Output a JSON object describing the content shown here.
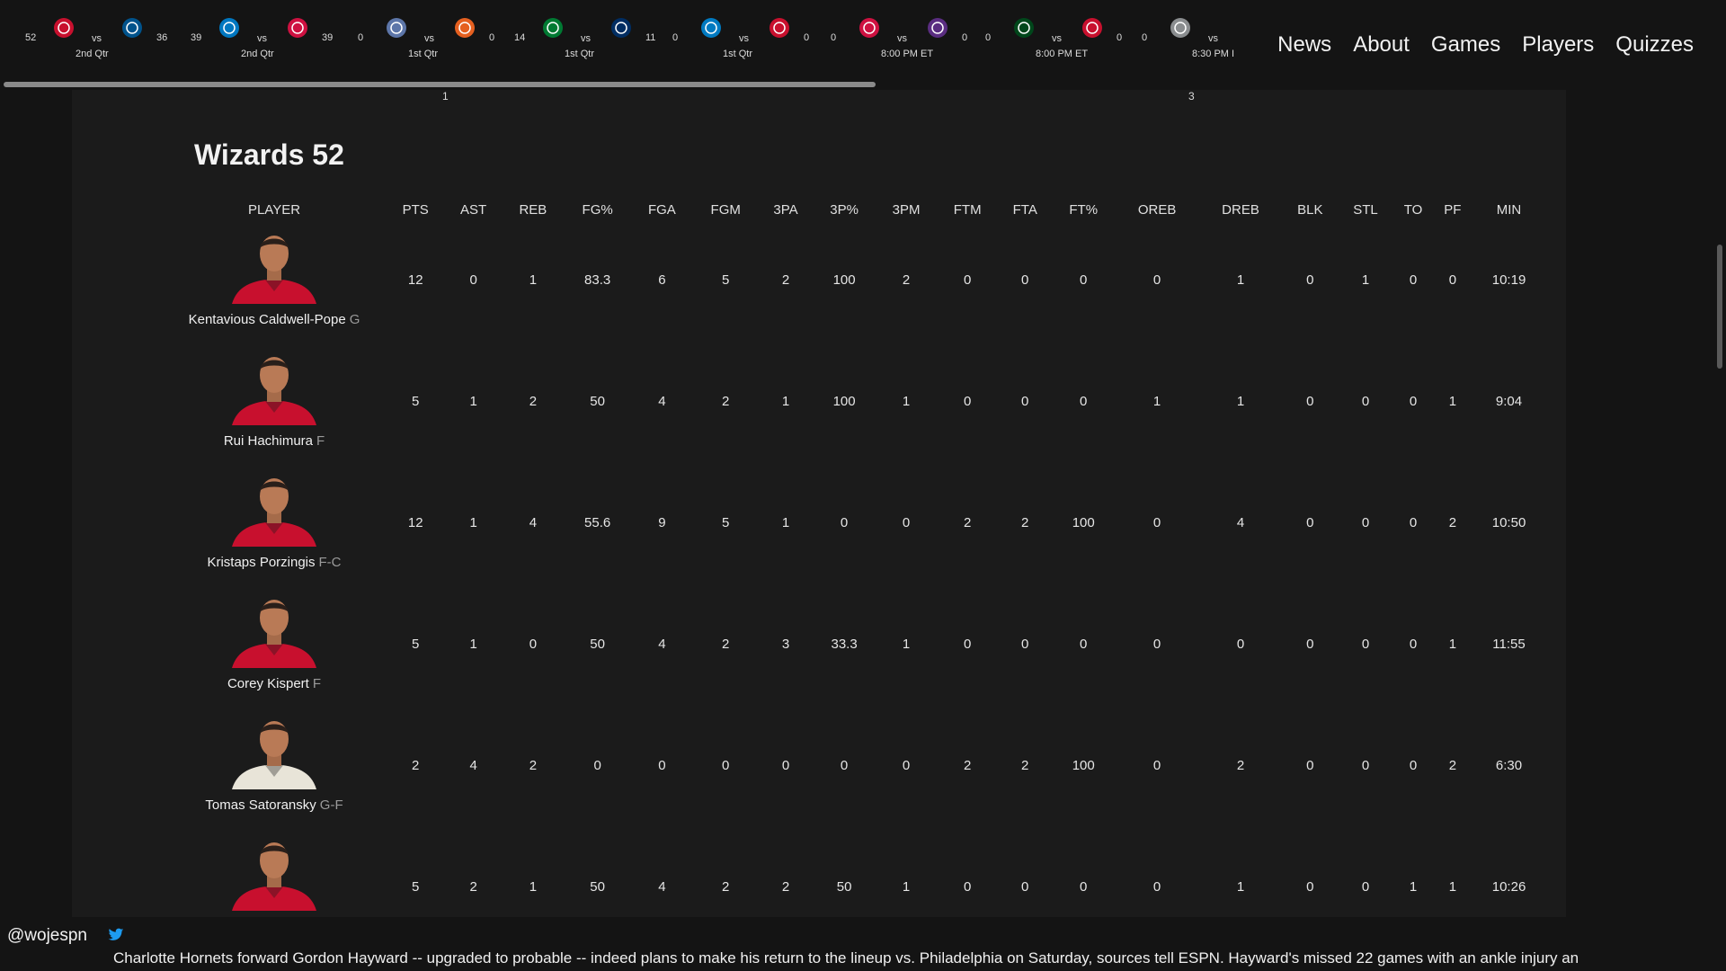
{
  "scores": [
    {
      "score_a": "52",
      "vs": "vs",
      "score_b": "36",
      "status": "2nd Qtr",
      "color_a": "#c8102e",
      "color_b": "#00538c",
      "logo_a": "wizards-logo",
      "logo_b": "mavericks-logo"
    },
    {
      "score_a": "39",
      "vs": "vs",
      "score_b": "39",
      "status": "2nd Qtr",
      "color_a": "#0077c0",
      "color_b": "#ce1141",
      "logo_a": "magic-logo",
      "logo_b": "raptors-logo"
    },
    {
      "score_a": "0",
      "vs": "vs",
      "score_b": "0",
      "status": "1st Qtr",
      "color_a": "#5d76a9",
      "color_b": "#e56020",
      "logo_a": "grizzlies-logo",
      "logo_b": "suns-logo"
    },
    {
      "score_a": "14",
      "vs": "vs",
      "score_b": "11",
      "status": "1st Qtr",
      "color_a": "#007a33",
      "color_b": "#002d62",
      "logo_a": "celtics-logo",
      "logo_b": "pacers-logo"
    },
    {
      "score_a": "0",
      "vs": "vs",
      "score_b": "0",
      "status": "1st Qtr",
      "color_a": "#007ac1",
      "color_b": "#c8102e",
      "logo_a": "thunder-logo",
      "logo_b": "pistons-logo"
    },
    {
      "score_a": "0",
      "vs": "vs",
      "score_b": "0",
      "status": "8:00 PM ET",
      "color_a": "#ce1141",
      "color_b": "#5a2d81",
      "logo_a": "rockets-logo",
      "logo_b": "kings-logo"
    },
    {
      "score_a": "0",
      "vs": "vs",
      "score_b": "0",
      "status": "8:00 PM ET",
      "color_a": "#00471b",
      "color_b": "#c8102e",
      "logo_a": "bucks-logo",
      "logo_b": "clippers-logo"
    },
    {
      "score_a": "0",
      "vs": "vs",
      "score_b": "",
      "status": "8:30 PM I",
      "color_a": "#8a8d8f",
      "color_b": "",
      "logo_a": "spurs-logo",
      "logo_b": ""
    }
  ],
  "stray": {
    "left": "1",
    "right": "3"
  },
  "nav": {
    "news": "News",
    "about": "About",
    "games": "Games",
    "players": "Players",
    "quizzes": "Quizzes"
  },
  "team_title": "Wizards 52",
  "columns": [
    "PLAYER",
    "PTS",
    "AST",
    "REB",
    "FG%",
    "FGA",
    "FGM",
    "3PA",
    "3P%",
    "3PM",
    "FTM",
    "FTA",
    "FT%",
    "OREB",
    "DREB",
    "BLK",
    "STL",
    "TO",
    "PF",
    "MIN"
  ],
  "players": [
    {
      "name": "Kentavious Caldwell-Pope",
      "pos": "G",
      "jersey": "#c8102e",
      "stats": [
        "12",
        "0",
        "1",
        "83.3",
        "6",
        "5",
        "2",
        "100",
        "2",
        "0",
        "0",
        "0",
        "0",
        "1",
        "0",
        "1",
        "0",
        "0",
        "10:19"
      ]
    },
    {
      "name": "Rui Hachimura",
      "pos": "F",
      "jersey": "#c8102e",
      "stats": [
        "5",
        "1",
        "2",
        "50",
        "4",
        "2",
        "1",
        "100",
        "1",
        "0",
        "0",
        "0",
        "1",
        "1",
        "0",
        "0",
        "0",
        "1",
        "9:04"
      ]
    },
    {
      "name": "Kristaps Porzingis",
      "pos": "F-C",
      "jersey": "#c8102e",
      "stats": [
        "12",
        "1",
        "4",
        "55.6",
        "9",
        "5",
        "1",
        "0",
        "0",
        "2",
        "2",
        "100",
        "0",
        "4",
        "0",
        "0",
        "0",
        "2",
        "10:50"
      ]
    },
    {
      "name": "Corey Kispert",
      "pos": "F",
      "jersey": "#c8102e",
      "stats": [
        "5",
        "1",
        "0",
        "50",
        "4",
        "2",
        "3",
        "33.3",
        "1",
        "0",
        "0",
        "0",
        "0",
        "0",
        "0",
        "0",
        "0",
        "1",
        "11:55"
      ]
    },
    {
      "name": "Tomas Satoransky",
      "pos": "G-F",
      "jersey": "#e8e4d8",
      "stats": [
        "2",
        "4",
        "2",
        "0",
        "0",
        "0",
        "0",
        "0",
        "0",
        "2",
        "2",
        "100",
        "0",
        "2",
        "0",
        "0",
        "0",
        "2",
        "6:30"
      ]
    },
    {
      "name": "",
      "pos": "",
      "jersey": "#c8102e",
      "stats": [
        "5",
        "2",
        "1",
        "50",
        "4",
        "2",
        "2",
        "50",
        "1",
        "0",
        "0",
        "0",
        "0",
        "1",
        "0",
        "0",
        "1",
        "1",
        "10:26"
      ]
    }
  ],
  "ticker": {
    "handle": "@wojespn",
    "tweet": "Charlotte Hornets forward Gordon Hayward -- upgraded to probable -- indeed plans to make his return to the lineup vs. Philadelphia on Saturday, sources tell ESPN. Hayward's missed 22 games with an ankle injury an",
    "twitter_color": "#1d9bf0"
  }
}
